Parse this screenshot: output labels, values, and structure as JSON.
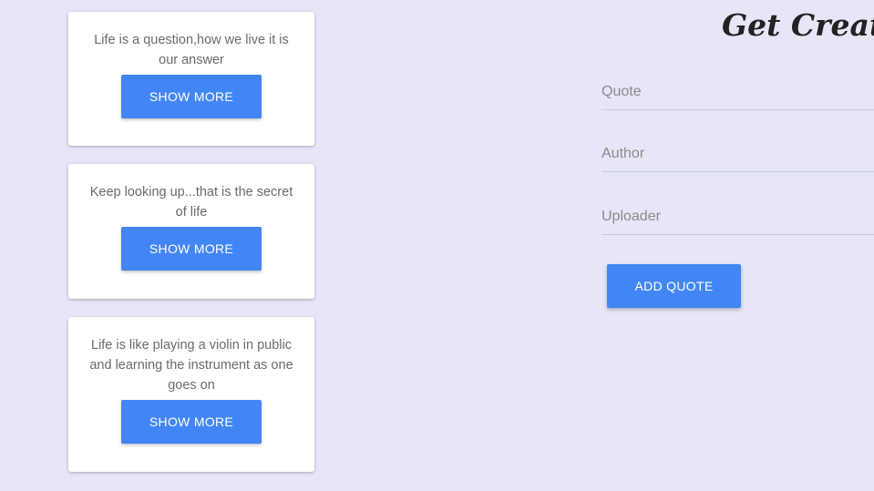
{
  "header": {
    "title": "Get Creative"
  },
  "quotes": [
    {
      "text": "Life is a question,how we live it is our answer",
      "button_label": "SHOW MORE"
    },
    {
      "text": "Keep looking up...that is the secret of life",
      "button_label": "SHOW MORE"
    },
    {
      "text": "Life is like playing a violin in public and learning the instrument as one goes on",
      "button_label": "SHOW MORE"
    }
  ],
  "form": {
    "quote_placeholder": "Quote",
    "quote_value": "",
    "author_placeholder": "Author",
    "author_value": "",
    "uploader_placeholder": "Uploader",
    "uploader_value": "",
    "submit_label": "ADD QUOTE"
  },
  "colors": {
    "background": "#e6e6f8",
    "accent": "#4285f4",
    "card": "#ffffff"
  }
}
